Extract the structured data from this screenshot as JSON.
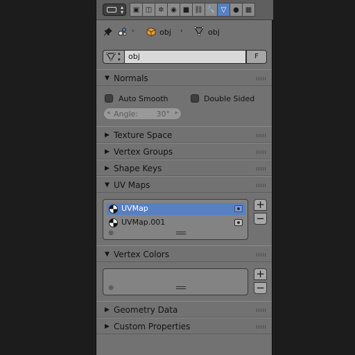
{
  "header": {
    "editor_type_icon": "properties-editor-icon",
    "tabs": [
      {
        "icon": "render-icon",
        "glyph": "▣"
      },
      {
        "icon": "render-layers-icon",
        "glyph": "◫"
      },
      {
        "icon": "scene-icon",
        "glyph": "✲"
      },
      {
        "icon": "world-icon",
        "glyph": "◉"
      },
      {
        "icon": "object-icon",
        "glyph": "■"
      },
      {
        "icon": "constraints-icon",
        "glyph": "⛓"
      },
      {
        "icon": "modifiers-icon",
        "glyph": "🔧"
      },
      {
        "icon": "mesh-data-icon",
        "glyph": "▽",
        "active": true
      },
      {
        "icon": "material-icon",
        "glyph": "●"
      },
      {
        "icon": "texture-icon",
        "glyph": "▦"
      }
    ]
  },
  "context": {
    "crumb1": "obj",
    "crumb2": "obj",
    "sep": "›"
  },
  "datablock": {
    "name": "obj",
    "fake_user": "F",
    "arrows": "▲▼"
  },
  "panels": {
    "normals": {
      "title": "Normals",
      "expanded": true,
      "auto_smooth": {
        "label": "Auto Smooth",
        "checked": false
      },
      "double_sided": {
        "label": "Double Sided",
        "checked": false
      },
      "angle": {
        "label": "Angle:",
        "value": "30°"
      }
    },
    "texture_space": {
      "title": "Texture Space",
      "expanded": false
    },
    "vertex_groups": {
      "title": "Vertex Groups",
      "expanded": false
    },
    "shape_keys": {
      "title": "Shape Keys",
      "expanded": false
    },
    "uv_maps": {
      "title": "UV Maps",
      "expanded": true,
      "items": [
        {
          "name": "UVMap",
          "selected": true
        },
        {
          "name": "UVMap.001",
          "selected": false
        }
      ]
    },
    "vertex_colors": {
      "title": "Vertex Colors",
      "expanded": true,
      "items": []
    },
    "geometry_data": {
      "title": "Geometry Data",
      "expanded": false
    },
    "custom_properties": {
      "title": "Custom Properties",
      "expanded": false
    }
  },
  "glyphs": {
    "expanded": "▼",
    "collapsed": "▶",
    "plus": "+",
    "minus": "−",
    "list_add": "⊕",
    "arrow_left": "◂",
    "arrow_right": "▸"
  },
  "colors": {
    "panel_bg": "#727272",
    "accent_selected": "#5680c2"
  }
}
